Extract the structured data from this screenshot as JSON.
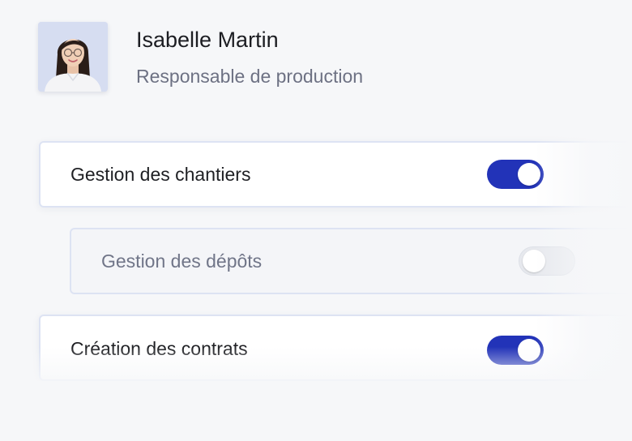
{
  "profile": {
    "name": "Isabelle Martin",
    "role": "Responsable de production"
  },
  "permissions": [
    {
      "label": "Gestion des chantiers",
      "enabled": true,
      "nested": false
    },
    {
      "label": "Gestion des dépôts",
      "enabled": false,
      "nested": true
    },
    {
      "label": "Création des contrats",
      "enabled": true,
      "nested": false
    }
  ],
  "colors": {
    "accent": "#2233b8",
    "background": "#f6f7f9",
    "card_border": "#dde3f3",
    "toggle_off": "#e7e9ee"
  }
}
